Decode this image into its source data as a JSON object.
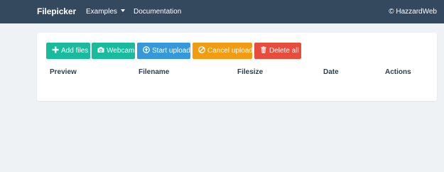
{
  "navbar": {
    "brand": "Filepicker",
    "examples": "Examples",
    "documentation": "Documentation",
    "credit": "© HazzardWeb"
  },
  "toolbar": {
    "add_files": "Add files",
    "webcam": "Webcam",
    "start_upload": "Start upload",
    "cancel_upload": "Cancel upload",
    "delete_all": "Delete all"
  },
  "table": {
    "headers": [
      "Preview",
      "Filename",
      "Filesize",
      "Date",
      "Actions"
    ]
  },
  "colors": {
    "navbar": "#34495e",
    "success": "#18bc9c",
    "primary": "#3498db",
    "warning": "#f39c12",
    "danger": "#e74c3c",
    "background": "#eff2f5"
  },
  "icons": {
    "add_files": "plus-icon",
    "webcam": "camera-icon",
    "start_upload": "upload-circle-icon",
    "cancel_upload": "cancel-circle-icon",
    "delete_all": "trash-icon",
    "examples_menu": "caret-down-icon"
  }
}
